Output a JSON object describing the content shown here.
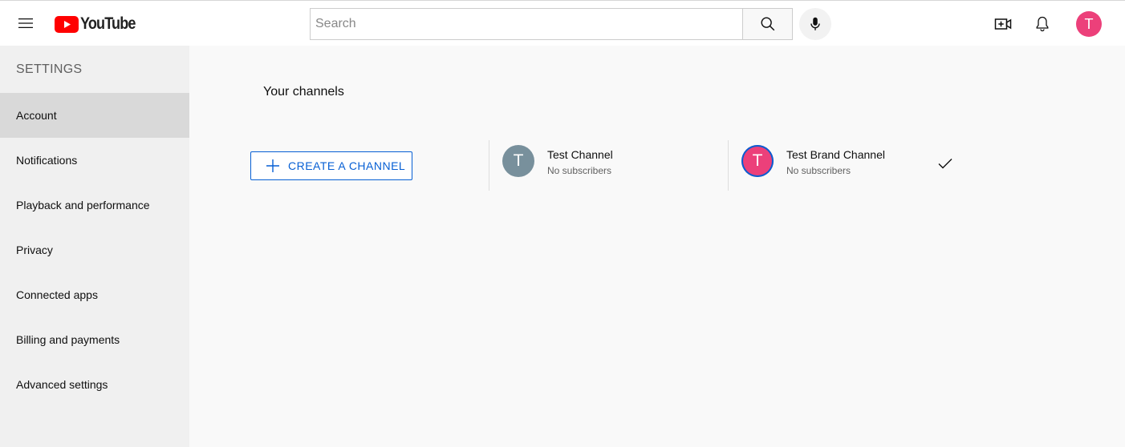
{
  "header": {
    "logo_text": "YouTube",
    "search_placeholder": "Search",
    "search_value": "",
    "avatar_initial": "T",
    "brand_color": "#ff0000",
    "avatar_color": "#ec407a",
    "icons": [
      "menu-icon",
      "youtube-logo-icon",
      "search-icon",
      "microphone-icon",
      "create-video-icon",
      "bell-icon"
    ]
  },
  "sidebar": {
    "title": "SETTINGS",
    "items": [
      {
        "label": "Account",
        "active": true
      },
      {
        "label": "Notifications",
        "active": false
      },
      {
        "label": "Playback and performance",
        "active": false
      },
      {
        "label": "Privacy",
        "active": false
      },
      {
        "label": "Connected apps",
        "active": false
      },
      {
        "label": "Billing and payments",
        "active": false
      },
      {
        "label": "Advanced settings",
        "active": false
      }
    ]
  },
  "main": {
    "title": "Your channels",
    "create_button_label": "CREATE A CHANNEL",
    "accent_color": "#065fd4",
    "channels": [
      {
        "initial": "T",
        "name": "Test Channel",
        "subscribers": "No subscribers",
        "avatar_color": "#78909c",
        "selected": false
      },
      {
        "initial": "T",
        "name": "Test Brand Channel",
        "subscribers": "No subscribers",
        "avatar_color": "#ec407a",
        "selected": true
      }
    ]
  }
}
